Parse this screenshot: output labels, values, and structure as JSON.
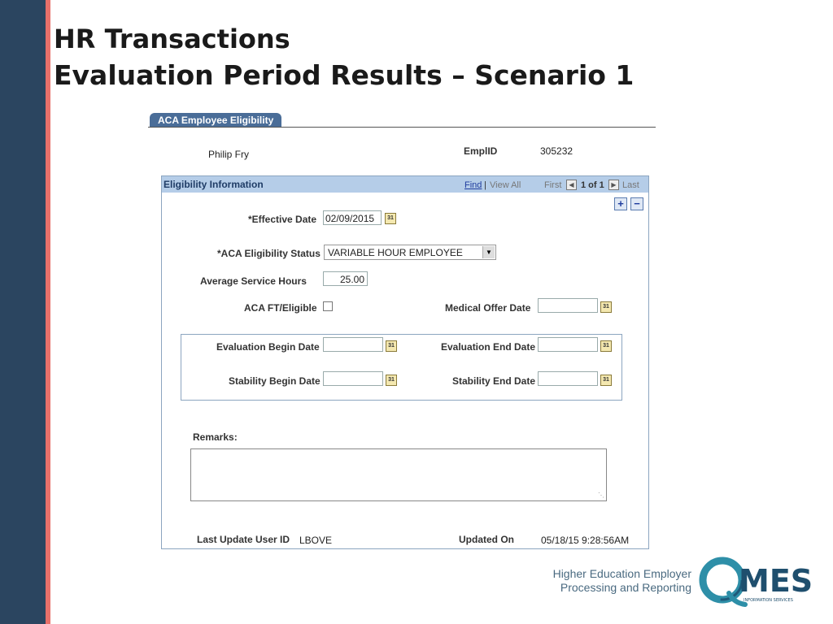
{
  "slide": {
    "title_line1": "HR Transactions",
    "title_line2": "Evaluation Period Results – Scenario 1"
  },
  "tab": {
    "label": "ACA Employee Eligibility"
  },
  "employee": {
    "name": "Philip Fry",
    "emplid_label": "EmplID",
    "emplid_value": "305232"
  },
  "panel": {
    "title": "Eligibility Information",
    "nav": {
      "find": "Find",
      "separator": "|",
      "view_all": "View All",
      "first": "First",
      "counter": "1 of 1",
      "last": "Last"
    }
  },
  "form": {
    "effective_date_label": "*Effective Date",
    "effective_date_value": "02/09/2015",
    "status_label": "*ACA Eligibility Status",
    "status_value": "VARIABLE HOUR EMPLOYEE",
    "avg_hours_label": "Average Service Hours",
    "avg_hours_value": "25.00",
    "ft_eligible_label": "ACA FT/Eligible",
    "medical_offer_label": "Medical Offer Date",
    "eval_begin_label": "Evaluation Begin Date",
    "eval_end_label": "Evaluation End Date",
    "stability_begin_label": "Stability Begin Date",
    "stability_end_label": "Stability End Date",
    "remarks_label": "Remarks:",
    "last_update_label": "Last Update User ID",
    "last_update_value": "LBOVE",
    "updated_on_label": "Updated On",
    "updated_on_value": "05/18/15  9:28:56AM"
  },
  "footer": {
    "line1": "Higher Education Employer",
    "line2": "Processing and Reporting",
    "logo_text": "MES",
    "logo_subtext": "INFORMATION SERVICES"
  },
  "colors": {
    "sidebar": "#2b4560",
    "accent": "#e8706a",
    "tab": "#4a6d98",
    "panel_header": "#b5cde8"
  }
}
